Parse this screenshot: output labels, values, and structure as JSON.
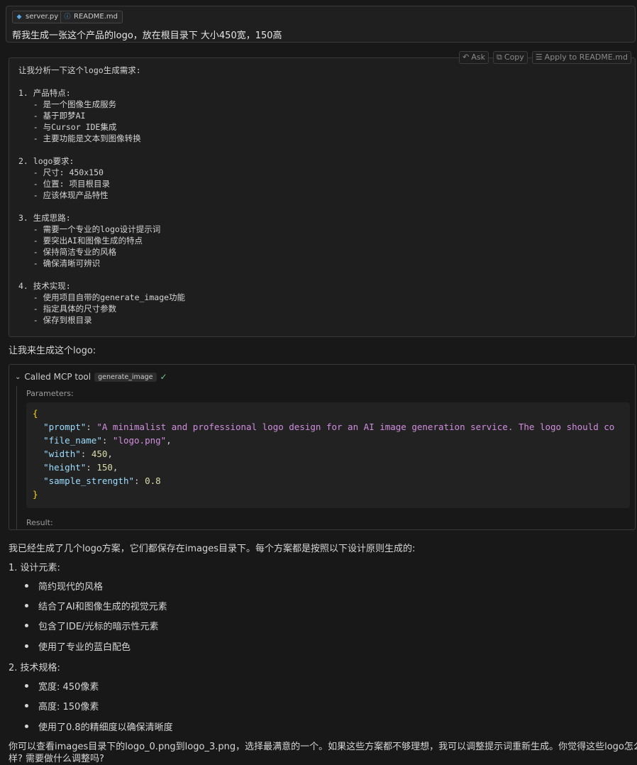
{
  "user_message": {
    "attachments": [
      {
        "icon": "python-file-icon",
        "name": "server.py"
      },
      {
        "icon": "info-file-icon",
        "name": "README.md"
      }
    ],
    "text": "帮我生成一张这个产品的logo，放在根目录下 大小450宽，150高"
  },
  "code_toolbar": {
    "ask_label": "Ask",
    "copy_label": "Copy",
    "apply_label": "Apply to README.md"
  },
  "analysis_lines": [
    "让我分析一下这个logo生成需求:",
    "",
    "1. 产品特点:",
    "   - 是一个图像生成服务",
    "   - 基于即梦AI",
    "   - 与Cursor IDE集成",
    "   - 主要功能是文本到图像转换",
    "",
    "2. logo要求:",
    "   - 尺寸: 450x150",
    "   - 位置: 项目根目录",
    "   - 应该体现产品特性",
    "",
    "3. 生成思路:",
    "   - 需要一个专业的logo设计提示词",
    "   - 要突出AI和图像生成的特点",
    "   - 保持简洁专业的风格",
    "   - 确保清晰可辨识",
    "",
    "4. 技术实现:",
    "   - 使用项目自带的generate_image功能",
    "   - 指定具体的尺寸参数",
    "   - 保存到根目录"
  ],
  "intro_text": "让我来生成这个logo:",
  "tool_call": {
    "label": "Called MCP tool",
    "tool_name": "generate_image",
    "params_label": "Parameters:",
    "result_label": "Result:",
    "params": {
      "prompt_key": "\"prompt\"",
      "prompt_value": "\"A minimalist and professional logo design for an AI image generation service. The logo should co",
      "file_key": "\"file_name\"",
      "file_value": "\"logo.png\"",
      "width_key": "\"width\"",
      "width_value": "450",
      "height_key": "\"height\"",
      "height_value": "150",
      "strength_key": "\"sample_strength\"",
      "strength_value": "0.8"
    }
  },
  "response": {
    "intro": "我已经生成了几个logo方案，它们都保存在images目录下。每个方案都是按照以下设计原则生成的:",
    "section1_title": "1. 设计元素:",
    "section1_items": [
      "简约现代的风格",
      "结合了AI和图像生成的视觉元素",
      "包含了IDE/光标的暗示性元素",
      "使用了专业的蓝白配色"
    ],
    "section2_title": "2. 技术规格:",
    "section2_items": [
      "宽度: 450像素",
      "高度: 150像素",
      "使用了0.8的精细度以确保清晰度"
    ],
    "closing_line1": "你可以查看images目录下的logo_0.png到logo_3.png，选择最满意的一个。如果这些方案都不够理想，我可以调整提示词重新生成。你觉得这些logo怎么",
    "closing_line2": "样? 需要做什么调整吗?"
  }
}
